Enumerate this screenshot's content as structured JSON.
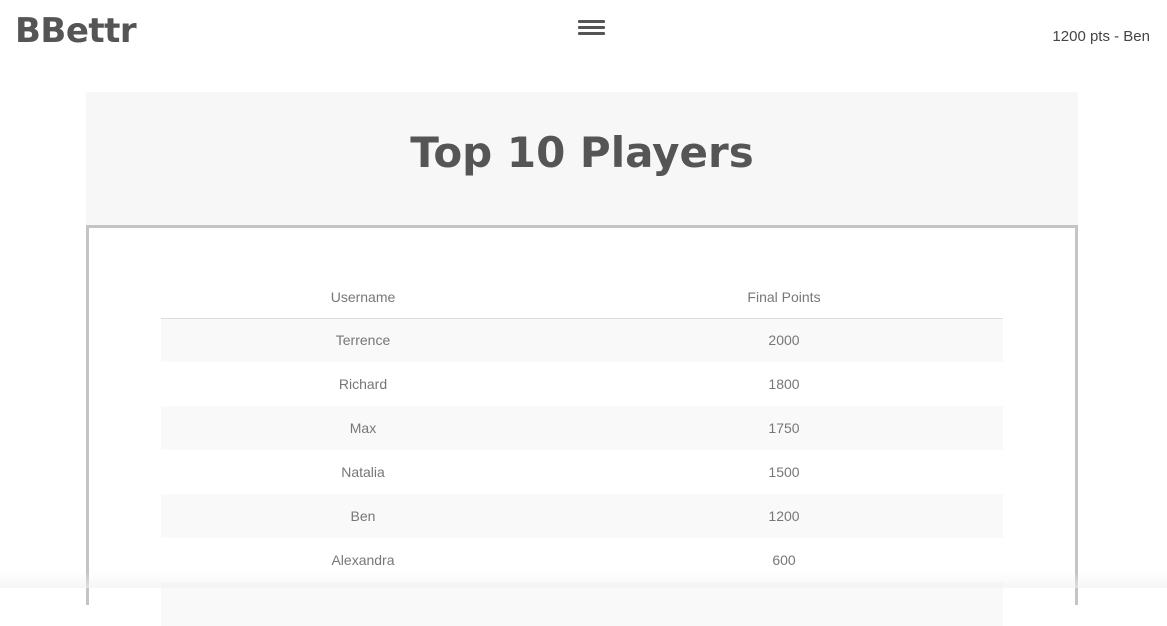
{
  "header": {
    "brand": "BBettr",
    "menu_icon": "hamburger-menu-icon",
    "user_status": "1200 pts - Ben"
  },
  "main": {
    "title": "Top 10 Players",
    "table": {
      "columns": [
        "Username",
        "Final Points"
      ],
      "rows": [
        {
          "username": "Terrence",
          "points": "2000"
        },
        {
          "username": "Richard",
          "points": "1800"
        },
        {
          "username": "Max",
          "points": "1750"
        },
        {
          "username": "Natalia",
          "points": "1500"
        },
        {
          "username": "Ben",
          "points": "1200"
        },
        {
          "username": "Alexandra",
          "points": "600"
        },
        {
          "username": "",
          "points": ""
        }
      ]
    }
  },
  "colors": {
    "text": "#555555",
    "header_bg": "#f7f7f7",
    "panel_border": "#c4c4c4",
    "stripe": "#f9f9f9"
  }
}
